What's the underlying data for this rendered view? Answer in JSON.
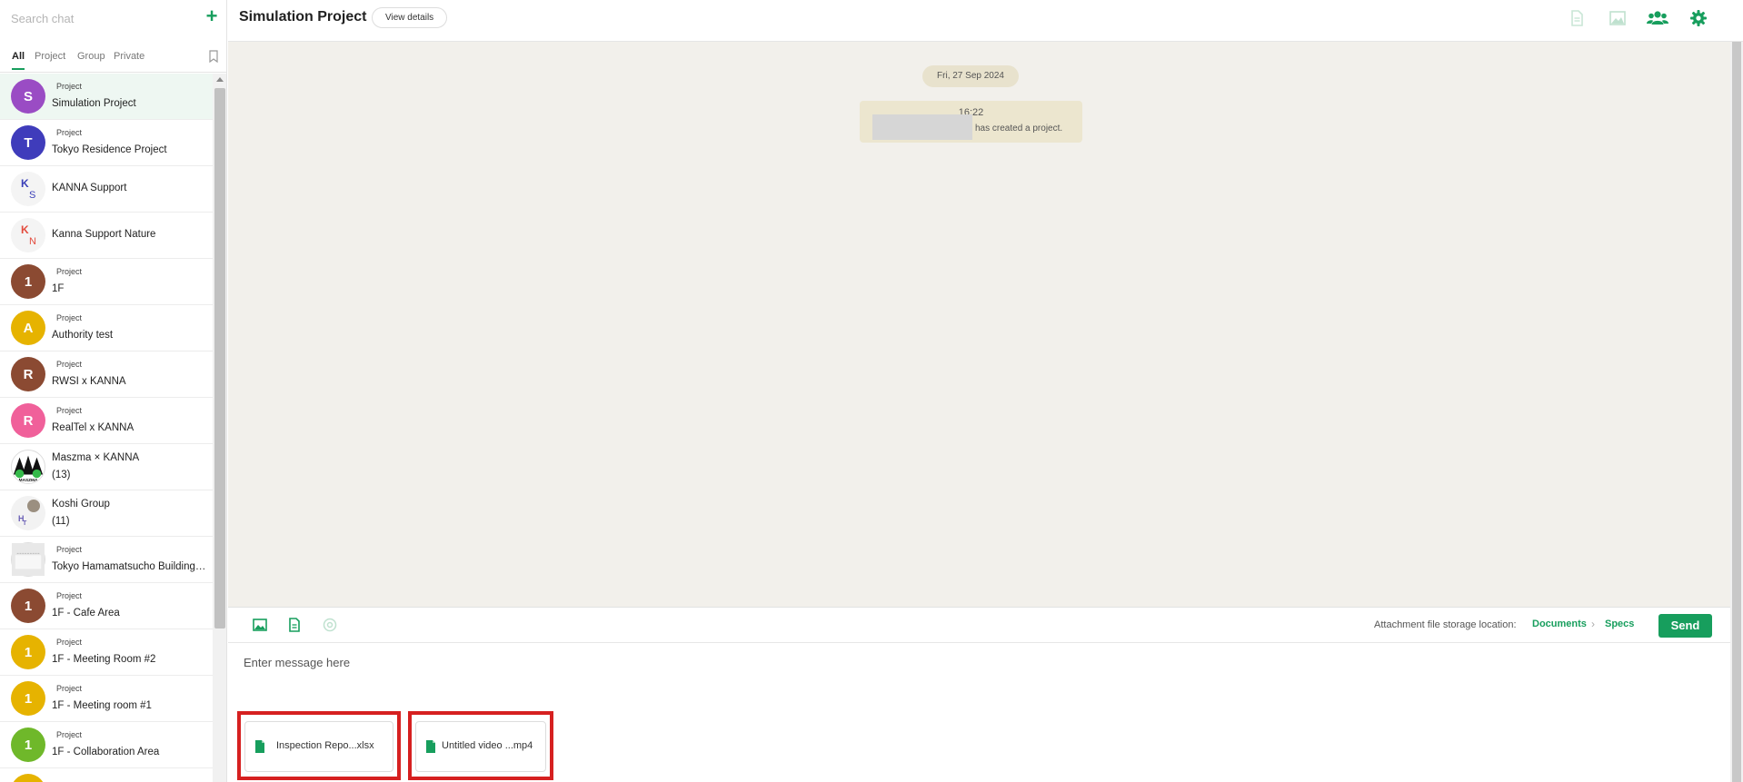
{
  "sidebar": {
    "search_placeholder": "Search chat",
    "add_icon": "plus-icon",
    "tabs": [
      {
        "label": "All",
        "active": true
      },
      {
        "label": "Project",
        "active": false
      },
      {
        "label": "Group",
        "active": false
      },
      {
        "label": "Private",
        "active": false
      }
    ],
    "chats": [
      {
        "tag": "Project",
        "name": "Simulation Project",
        "avatar_letter": "S",
        "avatar_color": "#9a4cc4",
        "selected": true
      },
      {
        "tag": "Project",
        "name": "Tokyo Residence Project",
        "avatar_letter": "T",
        "avatar_color": "#3f3cbb"
      },
      {
        "tag": "",
        "name": "KANNA Support",
        "avatar_letter": "K",
        "avatar_letter2": "S"
      },
      {
        "tag": "",
        "name": "Kanna Support Nature",
        "avatar_letter": "K",
        "avatar_letter2": "N"
      },
      {
        "tag": "Project",
        "name": "1F",
        "avatar_letter": "1",
        "avatar_color": "#8b4a32"
      },
      {
        "tag": "Project",
        "name": "Authority test",
        "avatar_letter": "A",
        "avatar_color": "#e6b300"
      },
      {
        "tag": "Project",
        "name": "RWSI x KANNA",
        "avatar_letter": "R",
        "avatar_color": "#8b4a32"
      },
      {
        "tag": "Project",
        "name": "RealTel x KANNA",
        "avatar_letter": "R",
        "avatar_color": "#f0609a"
      },
      {
        "tag": "",
        "name": "Maszma × KANNA",
        "count": "(13)",
        "avatar_caption": "MASZMA"
      },
      {
        "tag": "",
        "name": "Koshi Group",
        "count": "(11)",
        "avatar_letter": "H",
        "avatar_letter2": "T"
      },
      {
        "tag": "Project",
        "name": "Tokyo Hamamatsucho Building ..."
      },
      {
        "tag": "Project",
        "name": "1F - Cafe Area",
        "avatar_letter": "1",
        "avatar_color": "#8b4a32"
      },
      {
        "tag": "Project",
        "name": "1F - Meeting Room #2",
        "avatar_letter": "1",
        "avatar_color": "#e6b300"
      },
      {
        "tag": "Project",
        "name": "1F - Meeting room #1",
        "avatar_letter": "1",
        "avatar_color": "#e6b300"
      },
      {
        "tag": "Project",
        "name": "1F - Collaboration Area",
        "avatar_letter": "1",
        "avatar_color": "#6fb82a"
      }
    ]
  },
  "header": {
    "title": "Simulation Project",
    "view_details": "View details",
    "icons": [
      "document-icon",
      "image-icon",
      "members-icon",
      "settings-icon"
    ]
  },
  "chat": {
    "date": "Fri, 27 Sep 2024",
    "system_time": "16:22",
    "system_text": "has created a project."
  },
  "composer": {
    "storage_label": "Attachment file storage location:",
    "storage_path": [
      "Documents",
      "Specs"
    ],
    "send": "Send",
    "placeholder": "Enter message here",
    "attachments": [
      {
        "name": "Inspection Repo...xlsx"
      },
      {
        "name": "Untitled video ...mp4"
      }
    ]
  },
  "colors": {
    "accent": "#179e5d",
    "highlight": "#d62020"
  }
}
